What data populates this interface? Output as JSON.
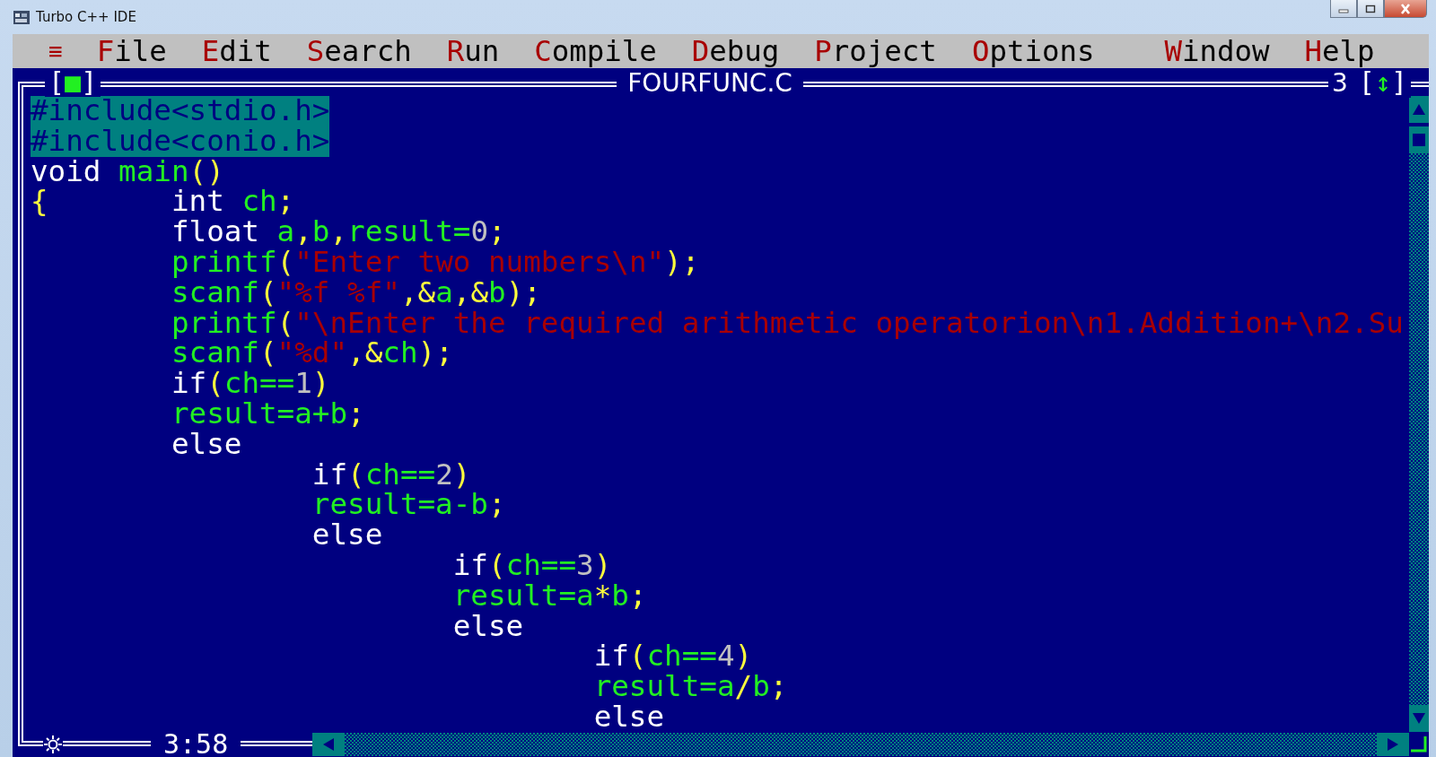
{
  "window": {
    "title": "Turbo C++ IDE"
  },
  "menu": [
    {
      "label": "≡",
      "kind": "system"
    },
    {
      "label": "File",
      "kind": "item"
    },
    {
      "label": "Edit",
      "kind": "item"
    },
    {
      "label": "Search",
      "kind": "item"
    },
    {
      "label": "Run",
      "kind": "item"
    },
    {
      "label": "Compile",
      "kind": "item"
    },
    {
      "label": "Debug",
      "kind": "item"
    },
    {
      "label": "Project",
      "kind": "item"
    },
    {
      "label": "Options",
      "kind": "item"
    },
    {
      "label": "Window",
      "kind": "item",
      "gap": true
    },
    {
      "label": "Help",
      "kind": "item"
    }
  ],
  "editor": {
    "close_box": "[■]",
    "title": "FOURFUNC.C",
    "window_number": "3",
    "zoom_box": "[↕]",
    "cursor_position": "3:58",
    "lines": [
      {
        "selected": true,
        "tokens": [
          {
            "kind": "directive",
            "text": "#include<stdio.h>"
          }
        ]
      },
      {
        "selected": true,
        "tokens": [
          {
            "kind": "directive",
            "text": "#include<conio.h>"
          }
        ]
      },
      {
        "selected": false,
        "tokens": [
          {
            "kind": "keyword",
            "text": "void"
          },
          {
            "kind": "ident",
            "text": " main"
          },
          {
            "kind": "punct",
            "text": "()"
          }
        ]
      },
      {
        "selected": false,
        "tokens": [
          {
            "kind": "punct",
            "text": "{"
          },
          {
            "kind": "keyword",
            "text": "       int"
          },
          {
            "kind": "ident",
            "text": " ch"
          },
          {
            "kind": "punct",
            "text": ";"
          }
        ]
      },
      {
        "selected": false,
        "tokens": [
          {
            "kind": "keyword",
            "text": "        float"
          },
          {
            "kind": "ident",
            "text": " a"
          },
          {
            "kind": "punct",
            "text": ","
          },
          {
            "kind": "ident",
            "text": "b"
          },
          {
            "kind": "punct",
            "text": ","
          },
          {
            "kind": "ident",
            "text": "result="
          },
          {
            "kind": "number",
            "text": "0"
          },
          {
            "kind": "punct",
            "text": ";"
          }
        ]
      },
      {
        "selected": false,
        "tokens": [
          {
            "kind": "ident",
            "text": "        printf"
          },
          {
            "kind": "punct",
            "text": "("
          },
          {
            "kind": "string",
            "text": "\"Enter two numbers\\n\""
          },
          {
            "kind": "punct",
            "text": ");"
          }
        ]
      },
      {
        "selected": false,
        "tokens": [
          {
            "kind": "ident",
            "text": "        scanf"
          },
          {
            "kind": "punct",
            "text": "("
          },
          {
            "kind": "string",
            "text": "\"%f %f\""
          },
          {
            "kind": "punct",
            "text": ",&"
          },
          {
            "kind": "ident",
            "text": "a"
          },
          {
            "kind": "punct",
            "text": ",&"
          },
          {
            "kind": "ident",
            "text": "b"
          },
          {
            "kind": "punct",
            "text": ");"
          }
        ]
      },
      {
        "selected": false,
        "tokens": [
          {
            "kind": "ident",
            "text": "        printf"
          },
          {
            "kind": "punct",
            "text": "("
          },
          {
            "kind": "string",
            "text": "\"\\nEnter the required arithmetic operatorion\\n1.Addition+\\n2.Su"
          }
        ]
      },
      {
        "selected": false,
        "tokens": [
          {
            "kind": "ident",
            "text": "        scanf"
          },
          {
            "kind": "punct",
            "text": "("
          },
          {
            "kind": "string",
            "text": "\"%d\""
          },
          {
            "kind": "punct",
            "text": ",&"
          },
          {
            "kind": "ident",
            "text": "ch"
          },
          {
            "kind": "punct",
            "text": ");"
          }
        ]
      },
      {
        "selected": false,
        "tokens": [
          {
            "kind": "keyword",
            "text": "        if"
          },
          {
            "kind": "punct",
            "text": "("
          },
          {
            "kind": "ident",
            "text": "ch=="
          },
          {
            "kind": "number",
            "text": "1"
          },
          {
            "kind": "punct",
            "text": ")"
          }
        ]
      },
      {
        "selected": false,
        "tokens": [
          {
            "kind": "ident",
            "text": "        result=a+b"
          },
          {
            "kind": "punct",
            "text": ";"
          }
        ]
      },
      {
        "selected": false,
        "tokens": [
          {
            "kind": "keyword",
            "text": "        else"
          }
        ]
      },
      {
        "selected": false,
        "tokens": [
          {
            "kind": "keyword",
            "text": "                if"
          },
          {
            "kind": "punct",
            "text": "("
          },
          {
            "kind": "ident",
            "text": "ch=="
          },
          {
            "kind": "number",
            "text": "2"
          },
          {
            "kind": "punct",
            "text": ")"
          }
        ]
      },
      {
        "selected": false,
        "tokens": [
          {
            "kind": "ident",
            "text": "                result=a-b"
          },
          {
            "kind": "punct",
            "text": ";"
          }
        ]
      },
      {
        "selected": false,
        "tokens": [
          {
            "kind": "keyword",
            "text": "                else"
          }
        ]
      },
      {
        "selected": false,
        "tokens": [
          {
            "kind": "keyword",
            "text": "                        if"
          },
          {
            "kind": "punct",
            "text": "("
          },
          {
            "kind": "ident",
            "text": "ch=="
          },
          {
            "kind": "number",
            "text": "3"
          },
          {
            "kind": "punct",
            "text": ")"
          }
        ]
      },
      {
        "selected": false,
        "tokens": [
          {
            "kind": "ident",
            "text": "                        result=a"
          },
          {
            "kind": "punct",
            "text": "*"
          },
          {
            "kind": "ident",
            "text": "b"
          },
          {
            "kind": "punct",
            "text": ";"
          }
        ]
      },
      {
        "selected": false,
        "tokens": [
          {
            "kind": "keyword",
            "text": "                        else"
          }
        ]
      },
      {
        "selected": false,
        "tokens": [
          {
            "kind": "keyword",
            "text": "                                if"
          },
          {
            "kind": "punct",
            "text": "("
          },
          {
            "kind": "ident",
            "text": "ch=="
          },
          {
            "kind": "number",
            "text": "4"
          },
          {
            "kind": "punct",
            "text": ")"
          }
        ]
      },
      {
        "selected": false,
        "tokens": [
          {
            "kind": "ident",
            "text": "                                result=a"
          },
          {
            "kind": "punct",
            "text": "/"
          },
          {
            "kind": "ident",
            "text": "b"
          },
          {
            "kind": "punct",
            "text": ";"
          }
        ]
      },
      {
        "selected": false,
        "tokens": [
          {
            "kind": "keyword",
            "text": "                                else"
          }
        ]
      }
    ]
  }
}
